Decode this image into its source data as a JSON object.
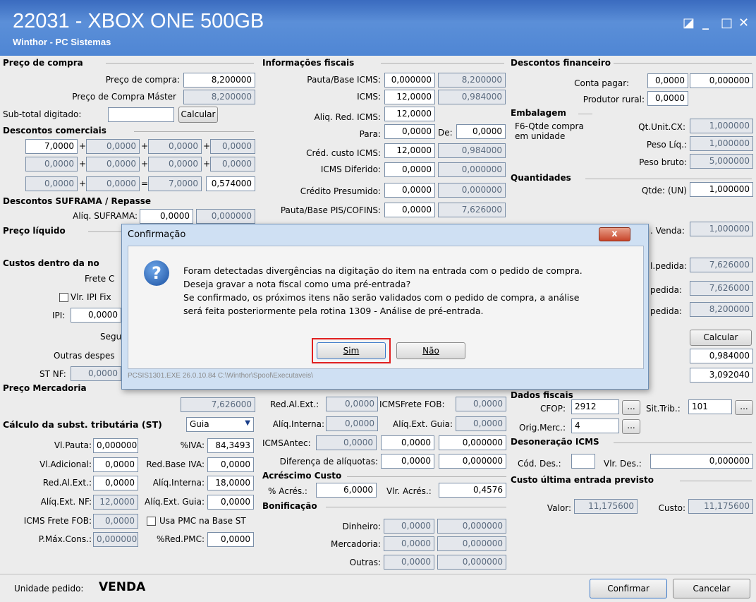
{
  "window": {
    "title": "22031 - XBOX ONE 500GB",
    "subtitle": "Winthor - PC Sistemas",
    "btn_restore": "◪",
    "btn_min": "_",
    "btn_max": "□",
    "btn_close": "✕"
  },
  "sections": {
    "preco_compra": "Preço de compra",
    "descontos_comerciais": "Descontos comerciais",
    "descontos_suframa": "Descontos SUFRAMA / Repasse",
    "preco_liquido": "Preço líquido",
    "custos_dentro": "Custos dentro da no",
    "preco_mercadoria": "Preço Mercadoria",
    "calculo_st": "Cálculo da subst. tributária (ST)",
    "info_fiscais": "Informações fiscais",
    "acrescimo_custo": "Acréscimo Custo",
    "bonificacao": "Bonificação",
    "descontos_financeiro": "Descontos financeiro",
    "embalagem": "Embalagem",
    "quantidades": "Quantidades",
    "dados_fiscais": "Dados fiscais",
    "desoneracao": "Desoneração ICMS",
    "custo_ultima": "Custo última entrada previsto"
  },
  "left": {
    "preco_compra_lbl": "Preço de compra:",
    "preco_compra_val": "8,200000",
    "preco_master_lbl": "Preço de Compra Máster",
    "preco_master_val": "8,200000",
    "subtotal_lbl": "Sub-total digitado:",
    "subtotal_val": "",
    "calcular": "Calcular",
    "dc": [
      [
        "7,0000",
        "0,0000",
        "0,0000",
        "0,0000"
      ],
      [
        "0,0000",
        "0,0000",
        "0,0000",
        "0,0000"
      ],
      [
        "0,0000",
        "0,0000",
        "7,0000",
        "0,574000"
      ]
    ],
    "plus": "+",
    "eq": "=",
    "aliq_suframa_lbl": "Alíq. SUFRAMA:",
    "aliq_suframa_val": "0,0000",
    "suframa_val2": "0,000000",
    "frete_lbl": "Frete C",
    "vlr_ipi_lbl": "Vlr. IPI Fix",
    "ipi_lbl": "IPI:",
    "ipi_val": "0,0000",
    "seguro_lbl": "Segu",
    "outras_lbl": "Outras despes",
    "stnf_lbl": "ST NF:",
    "stnf_val": "0,0000",
    "preco_merc_val": "7,626000",
    "guia": "Guia",
    "vlpauta_lbl": "Vl.Pauta:",
    "vlpauta_val": "0,000000",
    "iva_lbl": "%IVA:",
    "iva_val": "84,3493",
    "vladic_lbl": "Vl.Adicional:",
    "vladic_val": "0,0000",
    "redbase_lbl": "Red.Base IVA:",
    "redbase_val": "0,0000",
    "redal_lbl": "Red.Al.Ext.:",
    "redal_val": "0,0000",
    "aliqint_lbl": "Alíq.Interna:",
    "aliqint_val": "18,0000",
    "aliqextnf_lbl": "Alíq.Ext. NF:",
    "aliqextnf_val": "12,0000",
    "aliqextguia_lbl": "Alíq.Ext. Guia:",
    "aliqextguia_val": "0,0000",
    "icmsfretefob_lbl": "ICMS Frete FOB:",
    "icmsfretefob_val": "0,0000",
    "usapmc_lbl": "Usa PMC na Base ST",
    "pmax_lbl": "P.Máx.Cons.:",
    "pmax_val": "0,000000",
    "redpmc_lbl": "%Red.PMC:",
    "redpmc_val": "0,0000"
  },
  "mid": {
    "pauta_lbl": "Pauta/Base ICMS:",
    "pauta_v1": "0,000000",
    "pauta_v2": "8,200000",
    "icms_lbl": "ICMS:",
    "icms_v1": "12,0000",
    "icms_v2": "0,984000",
    "aliqred_lbl": "Aliq. Red. ICMS:",
    "aliqred_v1": "12,0000",
    "para_lbl": "Para:",
    "para_v1": "0,0000",
    "de_lbl": "De:",
    "de_v1": "0,0000",
    "cred_lbl": "Créd. custo ICMS:",
    "cred_v1": "12,0000",
    "cred_v2": "0,984000",
    "dif_lbl": "ICMS Diferido:",
    "dif_v1": "0,0000",
    "dif_v2": "0,000000",
    "presumido_lbl": "Crédito Presumido:",
    "presumido_v1": "0,0000",
    "presumido_v2": "0,000000",
    "pis_lbl": "Pauta/Base PIS/COFINS:",
    "pis_v1": "0,0000",
    "pis_v2": "7,626000",
    "redalext_lbl": "Red.Al.Ext.:",
    "redalext_v1": "0,0000",
    "icmsfrete_lbl": "ICMSFrete FOB:",
    "icmsfrete_v1": "0,0000",
    "aliqinterna_lbl": "Alíq.Interna:",
    "aliqinterna_v1": "0,0000",
    "aliqextguia_lbl": "Alíq.Ext. Guia:",
    "aliqextguia_v1": "0,0000",
    "icmsantec_lbl": "ICMSAntec:",
    "icmsantec_v1": "0,0000",
    "icmsantec_v2": "0,0000",
    "icmsantec_v3": "0,000000",
    "difaliq_lbl": "Diferença de alíquotas:",
    "difaliq_v1": "0,0000",
    "difaliq_v2": "0,000000",
    "acres_lbl": "% Acrés.:",
    "acres_v1": "6,0000",
    "vlracres_lbl": "Vlr. Acrés.:",
    "vlracres_v1": "0,4576",
    "dinheiro_lbl": "Dinheiro:",
    "dinheiro_v1": "0,0000",
    "dinheiro_v2": "0,000000",
    "mercadoria_lbl": "Mercadoria:",
    "mercadoria_v1": "0,0000",
    "mercadoria_v2": "0,000000",
    "outras_lbl": "Outras:",
    "outras_v1": "0,0000",
    "outras_v2": "0,000000"
  },
  "right": {
    "conta_lbl": "Conta pagar:",
    "conta_v1": "0,0000",
    "conta_v2": "0,000000",
    "produtor_lbl": "Produtor rural:",
    "produtor_v1": "0,0000",
    "f6_lbl1": "F6-Qtde compra",
    "f6_lbl2": "em unidade",
    "qtunit_lbl": "Qt.Unit.CX:",
    "qtunit_val": "1,000000",
    "pesoliq_lbl": "Peso Líq.:",
    "pesoliq_val": "1,000000",
    "pesobruto_lbl": "Peso bruto:",
    "pesobruto_val": "5,000000",
    "qtde_lbl": "Qtde: (UN)",
    "qtde_val": "1,000000",
    "venda_lbl": ". Venda:",
    "venda_val": "1,000000",
    "pedida1_lbl": "l.pedida:",
    "pedida1_val": "7,626000",
    "pedida2_lbl": "pedida:",
    "pedida2_val": "7,626000",
    "pedida3_lbl": "pedida:",
    "pedida3_val": "8,200000",
    "calcular": "Calcular",
    "r_val1": "0,984000",
    "r_val2": "3,092040",
    "cfop_lbl": "CFOP:",
    "cfop_val": "2912",
    "sittrib_lbl": "Sit.Trib.:",
    "sittrib_val": "101",
    "ellipsis": "...",
    "origmerc_lbl": "Orig.Merc.:",
    "origmerc_val": "4",
    "coddes_lbl": "Cód. Des.:",
    "coddes_val": "",
    "vlrdes_lbl": "Vlr. Des.:",
    "vlrdes_val": "0,000000",
    "valor_lbl": "Valor:",
    "valor_val": "11,175600",
    "custo_lbl": "Custo:",
    "custo_val": "11,175600"
  },
  "status": {
    "unidade_lbl": "Unidade pedido:",
    "unidade_val": "VENDA",
    "confirmar": "Confirmar",
    "cancelar": "Cancelar"
  },
  "dialog": {
    "title": "Confirmação",
    "close": "x",
    "line1": "Foram detectadas divergências na digitação do item na entrada com o pedido de compra.",
    "line2": "Deseja gravar a nota fiscal como uma pré-entrada?",
    "line3": "Se confirmado, os próximos itens não serão validados com o pedido de compra, a análise",
    "line4": "será feita posteriormente pela rotina 1309 - Análise de pré-entrada.",
    "sim": "Sim",
    "nao": "Não",
    "footer": "PCSIS1301.EXE 26.0.10.84 C:\\Winthor\\Spool\\Executaveis\\"
  },
  "colors": {
    "titlebar": "#4f86d4",
    "highlight": "#e02020",
    "dialog_bg": "#cfe0f3"
  }
}
